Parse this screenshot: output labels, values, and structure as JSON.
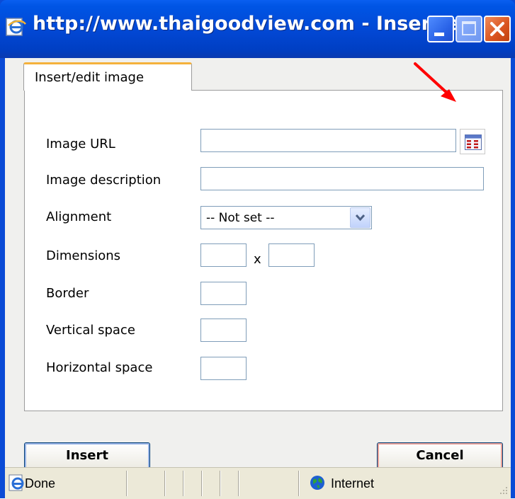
{
  "window": {
    "title": "http://www.thaigoodview.com - Insert/e..."
  },
  "tab": {
    "label": "Insert/edit image"
  },
  "form": {
    "image_url": {
      "label": "Image URL",
      "value": ""
    },
    "image_description": {
      "label": "Image description",
      "value": ""
    },
    "alignment": {
      "label": "Alignment",
      "selected": "-- Not set --"
    },
    "dimensions": {
      "label": "Dimensions",
      "width": "",
      "height": "",
      "separator": "x"
    },
    "border": {
      "label": "Border",
      "value": ""
    },
    "vertical_space": {
      "label": "Vertical space",
      "value": ""
    },
    "horizontal_space": {
      "label": "Horizontal space",
      "value": ""
    }
  },
  "buttons": {
    "insert": "Insert",
    "cancel": "Cancel"
  },
  "statusbar": {
    "status": "Done",
    "zone": "Internet"
  },
  "icons": {
    "browse": "browse-icon",
    "annotation": "red-arrow-icon"
  },
  "colors": {
    "title_bar": "#0247d3",
    "tab_accent": "#f4b13c",
    "annotation": "#ff0000"
  }
}
